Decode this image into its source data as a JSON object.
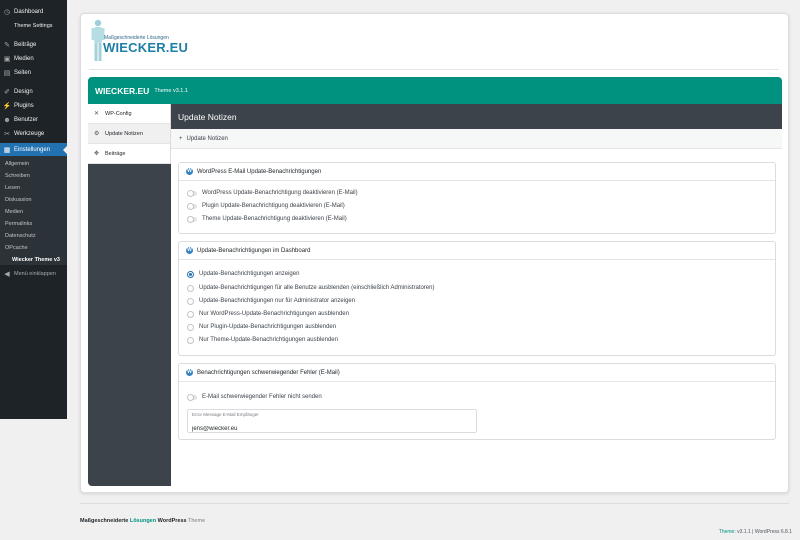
{
  "wp_menu": {
    "items": [
      {
        "label": "Dashboard",
        "icon": "gauge-icon"
      },
      {
        "label": "Theme Settings",
        "icon": ""
      },
      {
        "label": "Beiträge",
        "icon": "pushpin-icon"
      },
      {
        "label": "Medien",
        "icon": "media-icon"
      },
      {
        "label": "Seiten",
        "icon": "page-icon"
      },
      {
        "label": "Design",
        "icon": "brush-icon"
      },
      {
        "label": "Plugins",
        "icon": "plug-icon"
      },
      {
        "label": "Benutzer",
        "icon": "user-icon"
      },
      {
        "label": "Werkzeuge",
        "icon": "wrench-icon"
      },
      {
        "label": "Einstellungen",
        "icon": "settings-icon"
      }
    ],
    "submenu": [
      "Allgemein",
      "Schreiben",
      "Lesen",
      "Diskussion",
      "Medien",
      "Permalinks",
      "Datenschutz",
      "OPcache",
      "Wiecker Theme v3"
    ],
    "collapse_label": "Menü einklappen"
  },
  "logo": {
    "tagline": "Maßgeschneiderte Lösungen",
    "brand": "WIECKER.EU"
  },
  "theme_header": {
    "title": "WIECKER.EU",
    "version": "Theme v3.1.1"
  },
  "theme_nav": [
    {
      "label": "WP-Config",
      "icon": "tools-icon"
    },
    {
      "label": "Update Notizen",
      "icon": "gear-icon"
    },
    {
      "label": "Beiträge",
      "icon": "move-icon"
    }
  ],
  "content": {
    "title": "Update Notizen",
    "subtitle": "Update Notizen",
    "sections": [
      {
        "title": "WordPress E-Mail Update-Benachrichtigungen",
        "options": [
          "WordPress Update-Benachrichtigung deaktivieren (E-Mail)",
          "Plugin Update-Benachrichtigung deaktivieren (E-Mail)",
          "Theme Update-Benachrichtigung deaktivieren (E-Mail)"
        ]
      },
      {
        "title": "Update-Benachrichtigungen im Dashboard",
        "selected_index": 0,
        "options": [
          "Update-Benachrichtigungen anzeigen",
          "Update-Benachrichtigungen für alle Benutze ausblenden (einschließlich Administratoren)",
          "Update-Benachrichtigungen nur für Administrator anzeigen",
          "Nur WordPress-Update-Benachrichtigungen ausblenden",
          "Nur Plugin-Update-Benachrichtigungen ausblenden",
          "Nur Theme-Update-Benachrichtigungen ausblenden"
        ]
      },
      {
        "title": "Benachrichtigungen schwerwiegender Fehler (E-Mail)",
        "options": [
          "E-Mail schwerwiegender Fehler nicht senden"
        ],
        "email_label": "Error Message E-Mail Empfänger",
        "email_value": "jens@wiecker.eu"
      }
    ]
  },
  "footer": {
    "left_1": "Maßgeschneiderte",
    "left_2": "Lösungen",
    "left_3": "WordPress",
    "left_4": "Theme",
    "theme_label": "Theme:",
    "theme_version": "v3.1.1",
    "separator": "|",
    "wp_version": "WordPress 6.8.1"
  },
  "colors": {
    "accent": "#00927f",
    "wp_blue": "#2271b1",
    "sidebar": "#1d2327",
    "nav_dark": "#3c434a"
  }
}
